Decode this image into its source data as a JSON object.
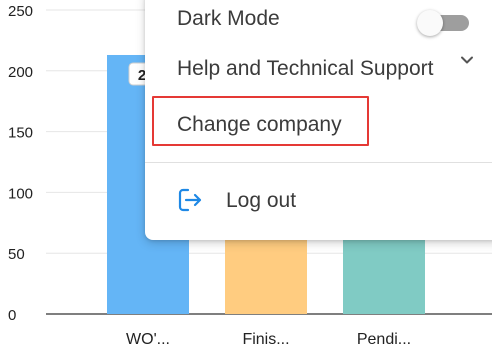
{
  "chart_data": {
    "type": "bar",
    "categories": [
      "WO'...",
      "Finis...",
      "Pendi..."
    ],
    "values": [
      213,
      88,
      88
    ],
    "value_labels": [
      "2",
      "",
      ""
    ],
    "ylim": [
      0,
      250
    ],
    "yticks": [
      0,
      50,
      100,
      150,
      200,
      250
    ],
    "grid": true,
    "colors": [
      "#64b5f6",
      "#ffcc80",
      "#80cbc4"
    ]
  },
  "menu": {
    "dark_mode_label": "Dark Mode",
    "dark_mode_on": false,
    "help_label": "Help and Technical Support",
    "change_company_label": "Change company",
    "logout_label": "Log out",
    "logout_icon_color": "#1e88e5",
    "highlight_color": "#e53935"
  }
}
